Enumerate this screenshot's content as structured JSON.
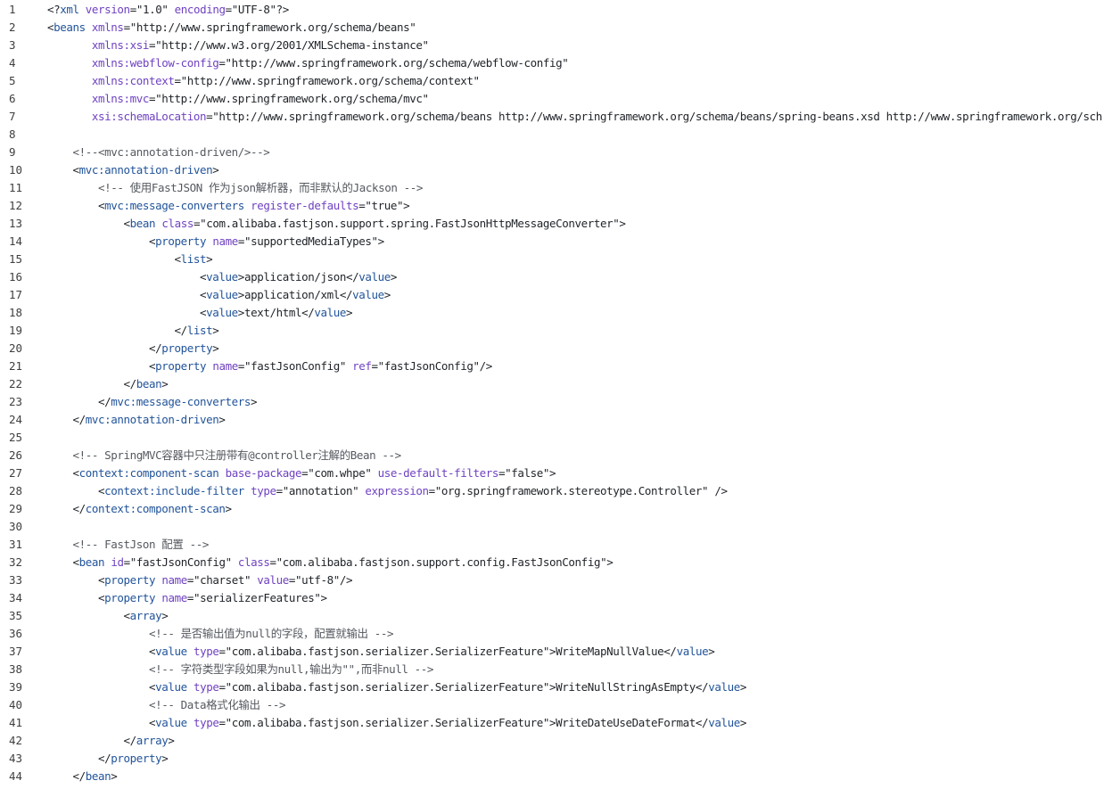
{
  "code_lines": [
    [
      [
        "punct",
        "<?"
      ],
      [
        "tag",
        "xml"
      ],
      [
        "text",
        " "
      ],
      [
        "attr",
        "version"
      ],
      [
        "punct",
        "="
      ],
      [
        "str",
        "\"1.0\""
      ],
      [
        "text",
        " "
      ],
      [
        "attr",
        "encoding"
      ],
      [
        "punct",
        "="
      ],
      [
        "str",
        "\"UTF-8\""
      ],
      [
        "punct",
        "?>"
      ]
    ],
    [
      [
        "punct",
        "<"
      ],
      [
        "tag",
        "beans"
      ],
      [
        "text",
        " "
      ],
      [
        "attr",
        "xmlns"
      ],
      [
        "punct",
        "="
      ],
      [
        "str",
        "\"http://www.springframework.org/schema/beans\""
      ]
    ],
    [
      [
        "text",
        "       "
      ],
      [
        "attr",
        "xmlns:xsi"
      ],
      [
        "punct",
        "="
      ],
      [
        "str",
        "\"http://www.w3.org/2001/XMLSchema-instance\""
      ]
    ],
    [
      [
        "text",
        "       "
      ],
      [
        "attr",
        "xmlns:webflow-config"
      ],
      [
        "punct",
        "="
      ],
      [
        "str",
        "\"http://www.springframework.org/schema/webflow-config\""
      ]
    ],
    [
      [
        "text",
        "       "
      ],
      [
        "attr",
        "xmlns:context"
      ],
      [
        "punct",
        "="
      ],
      [
        "str",
        "\"http://www.springframework.org/schema/context\""
      ]
    ],
    [
      [
        "text",
        "       "
      ],
      [
        "attr",
        "xmlns:mvc"
      ],
      [
        "punct",
        "="
      ],
      [
        "str",
        "\"http://www.springframework.org/schema/mvc\""
      ]
    ],
    [
      [
        "text",
        "       "
      ],
      [
        "attr",
        "xsi:schemaLocation"
      ],
      [
        "punct",
        "="
      ],
      [
        "str",
        "\"http://www.springframework.org/schema/beans http://www.springframework.org/schema/beans/spring-beans.xsd http://www.springframework.org/sch"
      ]
    ],
    [],
    [
      [
        "text",
        "    "
      ],
      [
        "comment",
        "<!--<mvc:annotation-driven/>-->"
      ]
    ],
    [
      [
        "text",
        "    "
      ],
      [
        "punct",
        "<"
      ],
      [
        "tag",
        "mvc:annotation-driven"
      ],
      [
        "punct",
        ">"
      ]
    ],
    [
      [
        "text",
        "        "
      ],
      [
        "comment",
        "<!-- 使用FastJSON 作为json解析器，而非默认的Jackson -->"
      ]
    ],
    [
      [
        "text",
        "        "
      ],
      [
        "punct",
        "<"
      ],
      [
        "tag",
        "mvc:message-converters"
      ],
      [
        "text",
        " "
      ],
      [
        "attr",
        "register-defaults"
      ],
      [
        "punct",
        "="
      ],
      [
        "str",
        "\"true\""
      ],
      [
        "punct",
        ">"
      ]
    ],
    [
      [
        "text",
        "            "
      ],
      [
        "punct",
        "<"
      ],
      [
        "tag",
        "bean"
      ],
      [
        "text",
        " "
      ],
      [
        "attr",
        "class"
      ],
      [
        "punct",
        "="
      ],
      [
        "str",
        "\"com.alibaba.fastjson.support.spring.FastJsonHttpMessageConverter\""
      ],
      [
        "punct",
        ">"
      ]
    ],
    [
      [
        "text",
        "                "
      ],
      [
        "punct",
        "<"
      ],
      [
        "tag",
        "property"
      ],
      [
        "text",
        " "
      ],
      [
        "attr",
        "name"
      ],
      [
        "punct",
        "="
      ],
      [
        "str",
        "\"supportedMediaTypes\""
      ],
      [
        "punct",
        ">"
      ]
    ],
    [
      [
        "text",
        "                    "
      ],
      [
        "punct",
        "<"
      ],
      [
        "tag",
        "list"
      ],
      [
        "punct",
        ">"
      ]
    ],
    [
      [
        "text",
        "                        "
      ],
      [
        "punct",
        "<"
      ],
      [
        "tag",
        "value"
      ],
      [
        "punct",
        ">"
      ],
      [
        "text",
        "application/json"
      ],
      [
        "punct",
        "</"
      ],
      [
        "tag",
        "value"
      ],
      [
        "punct",
        ">"
      ]
    ],
    [
      [
        "text",
        "                        "
      ],
      [
        "punct",
        "<"
      ],
      [
        "tag",
        "value"
      ],
      [
        "punct",
        ">"
      ],
      [
        "text",
        "application/xml"
      ],
      [
        "punct",
        "</"
      ],
      [
        "tag",
        "value"
      ],
      [
        "punct",
        ">"
      ]
    ],
    [
      [
        "text",
        "                        "
      ],
      [
        "punct",
        "<"
      ],
      [
        "tag",
        "value"
      ],
      [
        "punct",
        ">"
      ],
      [
        "text",
        "text/html"
      ],
      [
        "punct",
        "</"
      ],
      [
        "tag",
        "value"
      ],
      [
        "punct",
        ">"
      ]
    ],
    [
      [
        "text",
        "                    "
      ],
      [
        "punct",
        "</"
      ],
      [
        "tag",
        "list"
      ],
      [
        "punct",
        ">"
      ]
    ],
    [
      [
        "text",
        "                "
      ],
      [
        "punct",
        "</"
      ],
      [
        "tag",
        "property"
      ],
      [
        "punct",
        ">"
      ]
    ],
    [
      [
        "text",
        "                "
      ],
      [
        "punct",
        "<"
      ],
      [
        "tag",
        "property"
      ],
      [
        "text",
        " "
      ],
      [
        "attr",
        "name"
      ],
      [
        "punct",
        "="
      ],
      [
        "str",
        "\"fastJsonConfig\""
      ],
      [
        "text",
        " "
      ],
      [
        "attr",
        "ref"
      ],
      [
        "punct",
        "="
      ],
      [
        "str",
        "\"fastJsonConfig\""
      ],
      [
        "punct",
        "/>"
      ]
    ],
    [
      [
        "text",
        "            "
      ],
      [
        "punct",
        "</"
      ],
      [
        "tag",
        "bean"
      ],
      [
        "punct",
        ">"
      ]
    ],
    [
      [
        "text",
        "        "
      ],
      [
        "punct",
        "</"
      ],
      [
        "tag",
        "mvc:message-converters"
      ],
      [
        "punct",
        ">"
      ]
    ],
    [
      [
        "text",
        "    "
      ],
      [
        "punct",
        "</"
      ],
      [
        "tag",
        "mvc:annotation-driven"
      ],
      [
        "punct",
        ">"
      ]
    ],
    [],
    [
      [
        "text",
        "    "
      ],
      [
        "comment",
        "<!-- SpringMVC容器中只注册带有@controller注解的Bean -->"
      ]
    ],
    [
      [
        "text",
        "    "
      ],
      [
        "punct",
        "<"
      ],
      [
        "tag",
        "context:component-scan"
      ],
      [
        "text",
        " "
      ],
      [
        "attr",
        "base-package"
      ],
      [
        "punct",
        "="
      ],
      [
        "str",
        "\"com.whpe\""
      ],
      [
        "text",
        " "
      ],
      [
        "attr",
        "use-default-filters"
      ],
      [
        "punct",
        "="
      ],
      [
        "str",
        "\"false\""
      ],
      [
        "punct",
        ">"
      ]
    ],
    [
      [
        "text",
        "        "
      ],
      [
        "punct",
        "<"
      ],
      [
        "tag",
        "context:include-filter"
      ],
      [
        "text",
        " "
      ],
      [
        "attr",
        "type"
      ],
      [
        "punct",
        "="
      ],
      [
        "str",
        "\"annotation\""
      ],
      [
        "text",
        " "
      ],
      [
        "attr",
        "expression"
      ],
      [
        "punct",
        "="
      ],
      [
        "str",
        "\"org.springframework.stereotype.Controller\""
      ],
      [
        "text",
        " "
      ],
      [
        "punct",
        "/>"
      ]
    ],
    [
      [
        "text",
        "    "
      ],
      [
        "punct",
        "</"
      ],
      [
        "tag",
        "context:component-scan"
      ],
      [
        "punct",
        ">"
      ]
    ],
    [],
    [
      [
        "text",
        "    "
      ],
      [
        "comment",
        "<!-- FastJson 配置 -->"
      ]
    ],
    [
      [
        "text",
        "    "
      ],
      [
        "punct",
        "<"
      ],
      [
        "tag",
        "bean"
      ],
      [
        "text",
        " "
      ],
      [
        "attr",
        "id"
      ],
      [
        "punct",
        "="
      ],
      [
        "str",
        "\"fastJsonConfig\""
      ],
      [
        "text",
        " "
      ],
      [
        "attr",
        "class"
      ],
      [
        "punct",
        "="
      ],
      [
        "str",
        "\"com.alibaba.fastjson.support.config.FastJsonConfig\""
      ],
      [
        "punct",
        ">"
      ]
    ],
    [
      [
        "text",
        "        "
      ],
      [
        "punct",
        "<"
      ],
      [
        "tag",
        "property"
      ],
      [
        "text",
        " "
      ],
      [
        "attr",
        "name"
      ],
      [
        "punct",
        "="
      ],
      [
        "str",
        "\"charset\""
      ],
      [
        "text",
        " "
      ],
      [
        "attr",
        "value"
      ],
      [
        "punct",
        "="
      ],
      [
        "str",
        "\"utf-8\""
      ],
      [
        "punct",
        "/>"
      ]
    ],
    [
      [
        "text",
        "        "
      ],
      [
        "punct",
        "<"
      ],
      [
        "tag",
        "property"
      ],
      [
        "text",
        " "
      ],
      [
        "attr",
        "name"
      ],
      [
        "punct",
        "="
      ],
      [
        "str",
        "\"serializerFeatures\""
      ],
      [
        "punct",
        ">"
      ]
    ],
    [
      [
        "text",
        "            "
      ],
      [
        "punct",
        "<"
      ],
      [
        "tag",
        "array"
      ],
      [
        "punct",
        ">"
      ]
    ],
    [
      [
        "text",
        "                "
      ],
      [
        "comment",
        "<!-- 是否输出值为null的字段，配置就输出 -->"
      ]
    ],
    [
      [
        "text",
        "                "
      ],
      [
        "punct",
        "<"
      ],
      [
        "tag",
        "value"
      ],
      [
        "text",
        " "
      ],
      [
        "attr",
        "type"
      ],
      [
        "punct",
        "="
      ],
      [
        "str",
        "\"com.alibaba.fastjson.serializer.SerializerFeature\""
      ],
      [
        "punct",
        ">"
      ],
      [
        "text",
        "WriteMapNullValue"
      ],
      [
        "punct",
        "</"
      ],
      [
        "tag",
        "value"
      ],
      [
        "punct",
        ">"
      ]
    ],
    [
      [
        "text",
        "                "
      ],
      [
        "comment",
        "<!-- 字符类型字段如果为null,输出为\"\",而非null -->"
      ]
    ],
    [
      [
        "text",
        "                "
      ],
      [
        "punct",
        "<"
      ],
      [
        "tag",
        "value"
      ],
      [
        "text",
        " "
      ],
      [
        "attr",
        "type"
      ],
      [
        "punct",
        "="
      ],
      [
        "str",
        "\"com.alibaba.fastjson.serializer.SerializerFeature\""
      ],
      [
        "punct",
        ">"
      ],
      [
        "text",
        "WriteNullStringAsEmpty"
      ],
      [
        "punct",
        "</"
      ],
      [
        "tag",
        "value"
      ],
      [
        "punct",
        ">"
      ]
    ],
    [
      [
        "text",
        "                "
      ],
      [
        "comment",
        "<!-- Data格式化输出 -->"
      ]
    ],
    [
      [
        "text",
        "                "
      ],
      [
        "punct",
        "<"
      ],
      [
        "tag",
        "value"
      ],
      [
        "text",
        " "
      ],
      [
        "attr",
        "type"
      ],
      [
        "punct",
        "="
      ],
      [
        "str",
        "\"com.alibaba.fastjson.serializer.SerializerFeature\""
      ],
      [
        "punct",
        ">"
      ],
      [
        "text",
        "WriteDateUseDateFormat"
      ],
      [
        "punct",
        "</"
      ],
      [
        "tag",
        "value"
      ],
      [
        "punct",
        ">"
      ]
    ],
    [
      [
        "text",
        "            "
      ],
      [
        "punct",
        "</"
      ],
      [
        "tag",
        "array"
      ],
      [
        "punct",
        ">"
      ]
    ],
    [
      [
        "text",
        "        "
      ],
      [
        "punct",
        "</"
      ],
      [
        "tag",
        "property"
      ],
      [
        "punct",
        ">"
      ]
    ],
    [
      [
        "text",
        "    "
      ],
      [
        "punct",
        "</"
      ],
      [
        "tag",
        "bean"
      ],
      [
        "punct",
        ">"
      ]
    ]
  ],
  "line_numbers": [
    "1",
    "2",
    "3",
    "4",
    "5",
    "6",
    "7",
    "8",
    "9",
    "10",
    "11",
    "12",
    "13",
    "14",
    "15",
    "16",
    "17",
    "18",
    "19",
    "20",
    "21",
    "22",
    "23",
    "24",
    "25",
    "26",
    "27",
    "28",
    "29",
    "30",
    "31",
    "32",
    "33",
    "34",
    "35",
    "36",
    "37",
    "38",
    "39",
    "40",
    "41",
    "42",
    "43",
    "44"
  ]
}
